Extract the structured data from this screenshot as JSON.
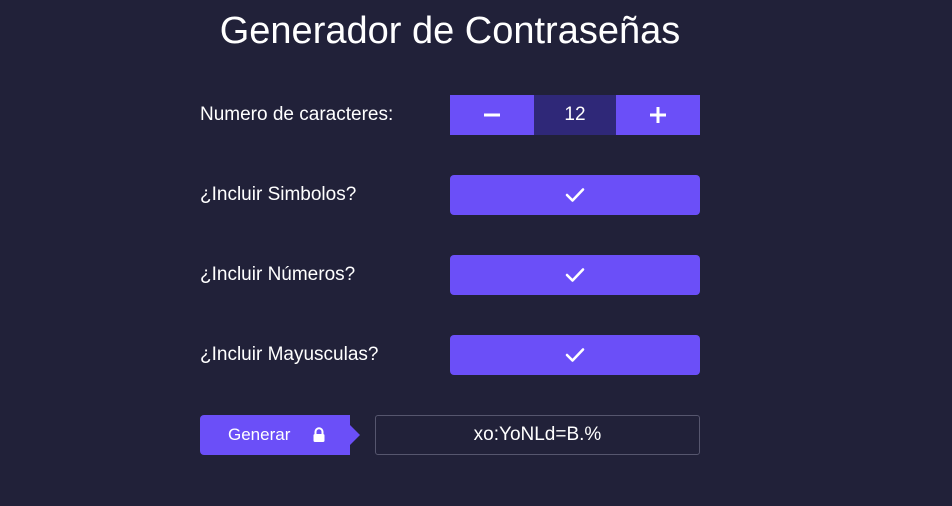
{
  "title": "Generador de Contraseñas",
  "length": {
    "label": "Numero de caracteres:",
    "value": "12",
    "decrement_icon": "minus-icon",
    "increment_icon": "plus-icon"
  },
  "options": [
    {
      "label": "¿Incluir Simbolos?",
      "checked": true,
      "icon": "check-icon"
    },
    {
      "label": "¿Incluir Números?",
      "checked": true,
      "icon": "check-icon"
    },
    {
      "label": "¿Incluir Mayusculas?",
      "checked": true,
      "icon": "check-icon"
    }
  ],
  "generate": {
    "label": "Generar",
    "icon": "lock-icon"
  },
  "password": "xo:YoNLd=B.%",
  "colors": {
    "background": "#212139",
    "accent": "#6b4ff8",
    "counter_value_bg": "#2f2878",
    "text": "#ffffff"
  }
}
